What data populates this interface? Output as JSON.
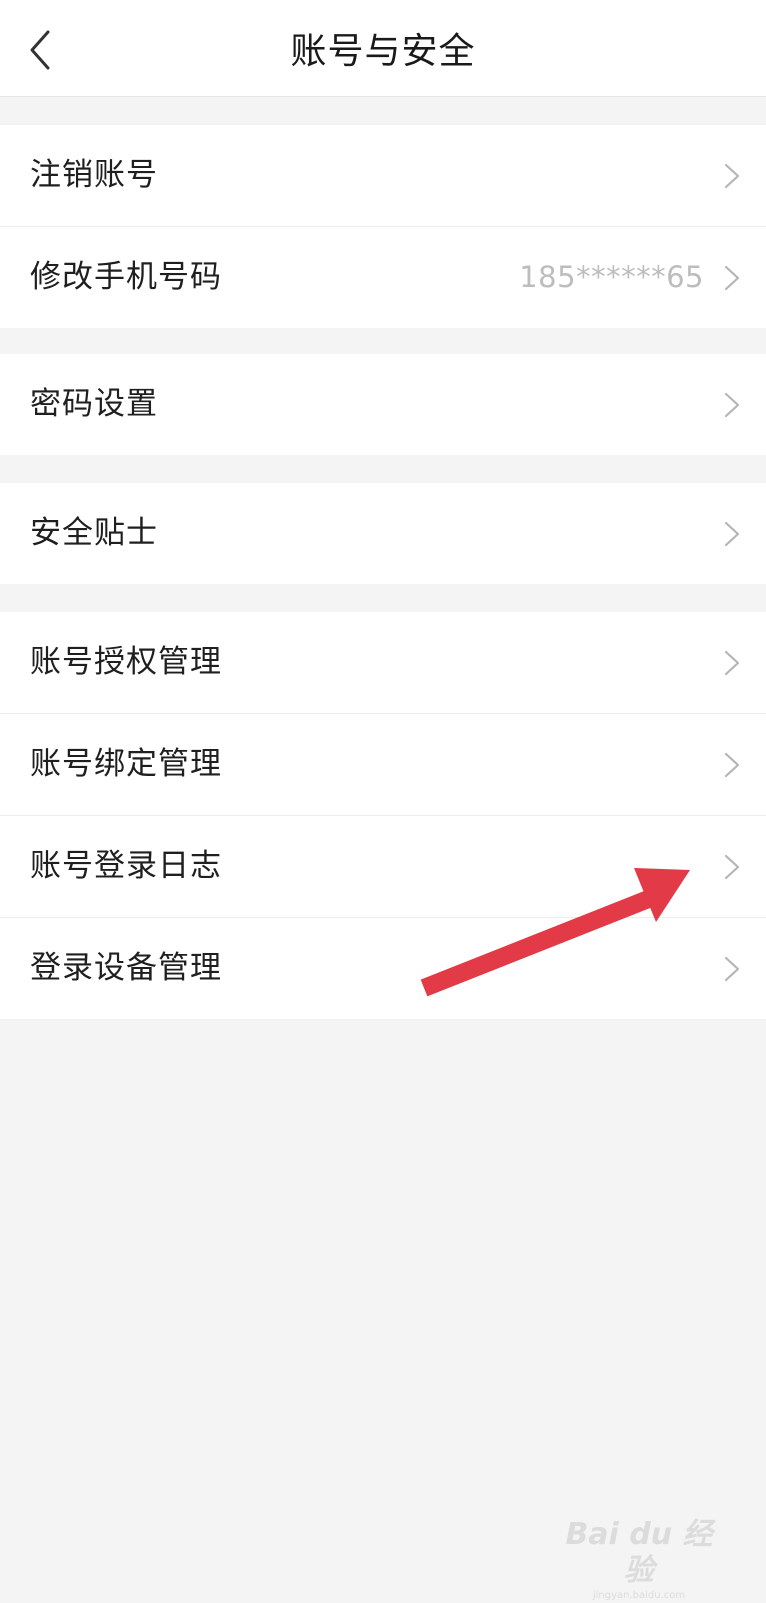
{
  "header": {
    "title": "账号与安全",
    "back_icon": "chevron-left-icon"
  },
  "groups": [
    {
      "items": [
        {
          "label": "注销账号",
          "value": ""
        },
        {
          "label": "修改手机号码",
          "value": "185******65"
        }
      ]
    },
    {
      "items": [
        {
          "label": "密码设置",
          "value": ""
        }
      ]
    },
    {
      "items": [
        {
          "label": "安全贴士",
          "value": ""
        }
      ]
    },
    {
      "items": [
        {
          "label": "账号授权管理",
          "value": ""
        },
        {
          "label": "账号绑定管理",
          "value": ""
        },
        {
          "label": "账号登录日志",
          "value": ""
        },
        {
          "label": "登录设备管理",
          "value": ""
        }
      ]
    }
  ],
  "annotation": {
    "icon": "red-arrow-icon",
    "color": "#e23a46"
  },
  "watermark": {
    "brand": "Bai du 经验",
    "url": "jingyan.baidu.com"
  },
  "colors": {
    "background": "#f4f4f4",
    "surface": "#ffffff",
    "text_primary": "#1f1f1f",
    "text_secondary": "#bdbdbd",
    "chevron": "#b5b5b5"
  }
}
